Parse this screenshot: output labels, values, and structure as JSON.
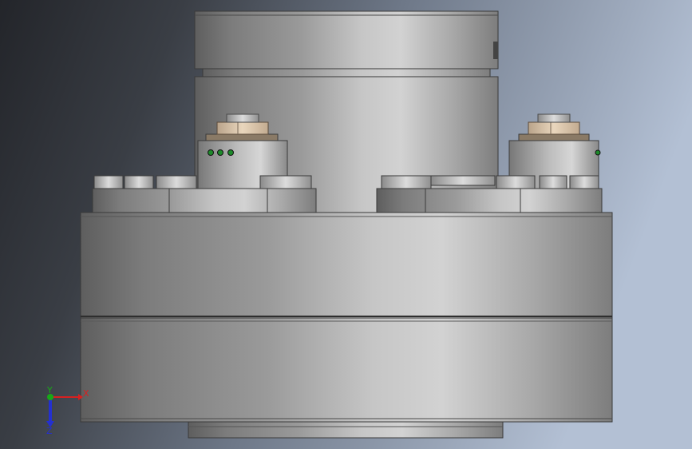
{
  "viewport": {
    "background": {
      "left": "#2a2c30",
      "mid": "#606a78",
      "right": "#aebbd0"
    },
    "metal": {
      "dark": "#5d5d5d",
      "mid": "#8e8e8e",
      "light": "#c9c9c9",
      "edge": "#3b3b3b"
    },
    "nut_color": "#d9c2a6",
    "hole_color": "#1d8a2a"
  },
  "triad": {
    "x_label": "X",
    "y_label": "Y",
    "z_label": "Z",
    "x_color": "#d82020",
    "y_color": "#18a818",
    "z_color": "#2430d0"
  }
}
